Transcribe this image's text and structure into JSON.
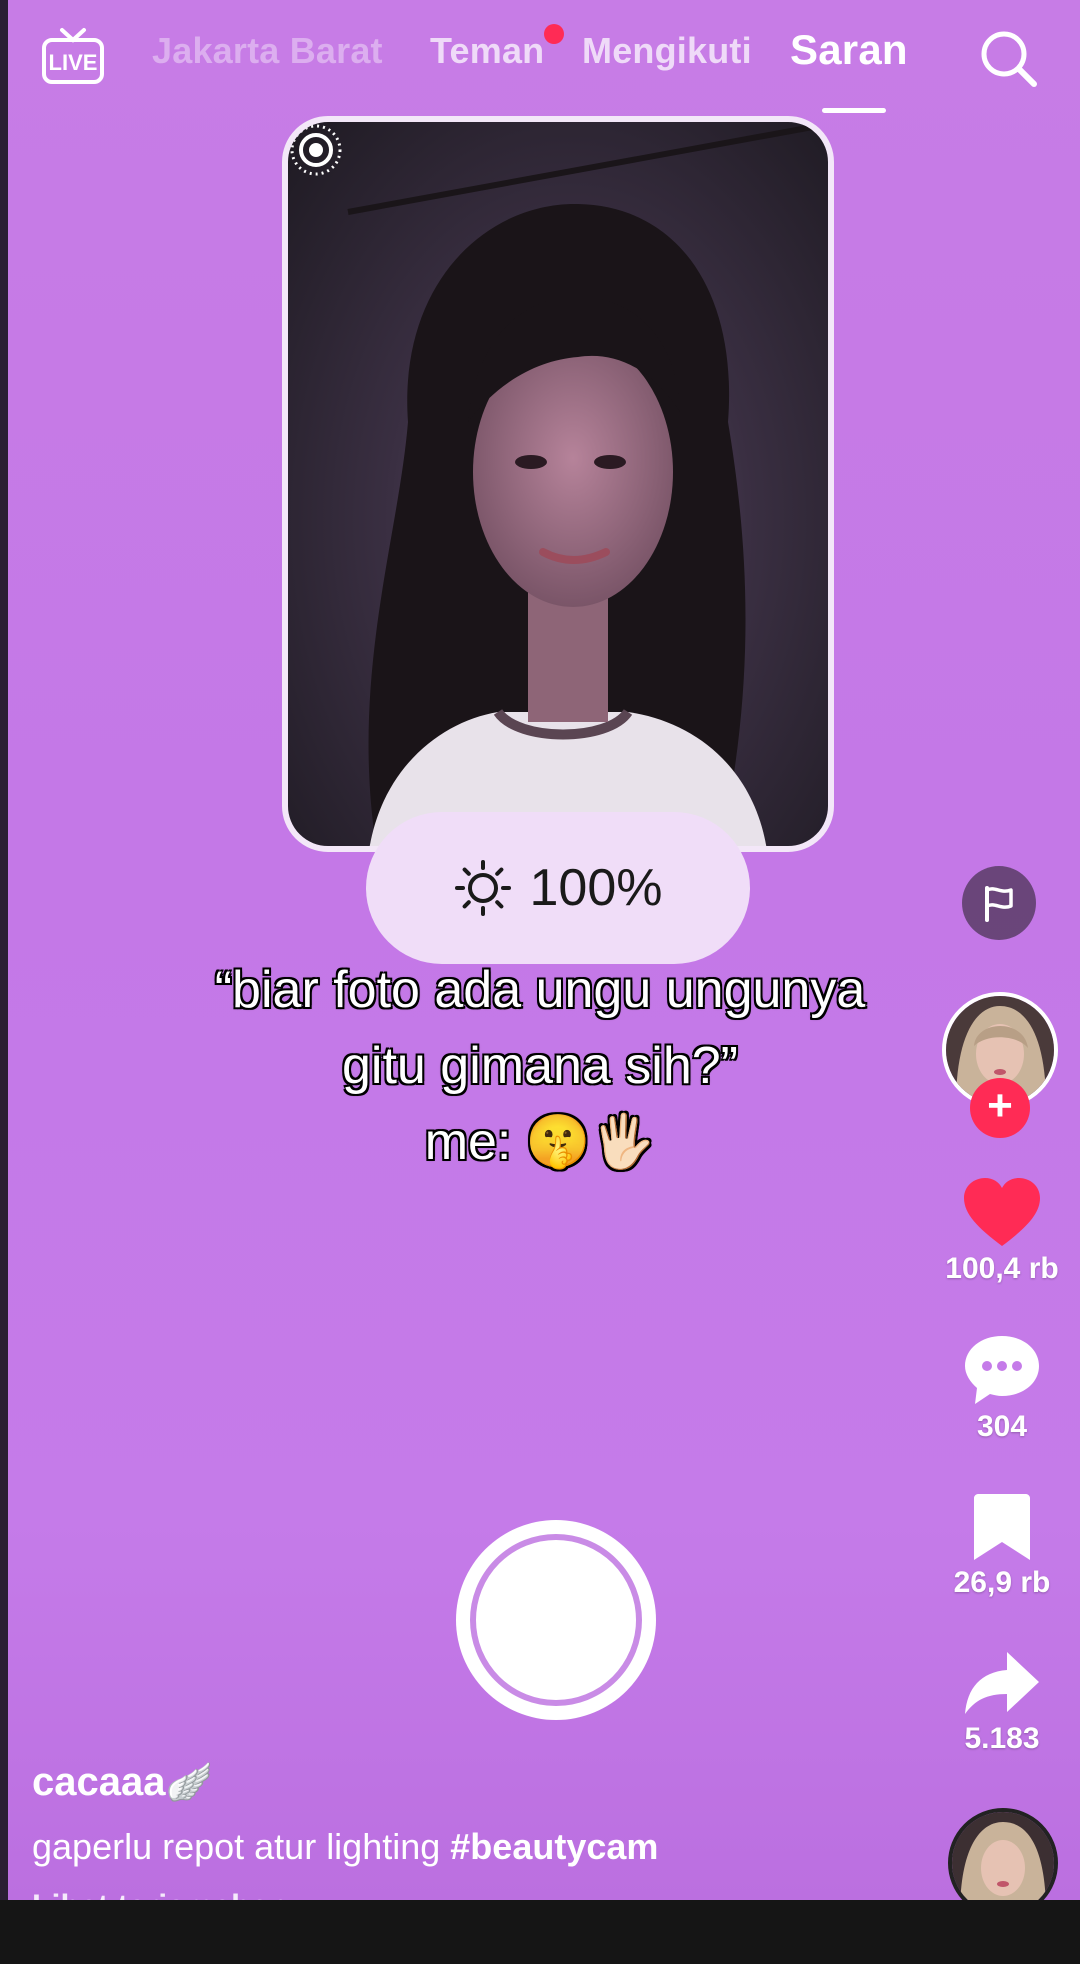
{
  "top_nav": {
    "live_label": "LIVE",
    "tabs": [
      {
        "label": "Jakarta Barat"
      },
      {
        "label": "Teman"
      },
      {
        "label": "Mengikuti"
      },
      {
        "label": "Saran"
      }
    ]
  },
  "camera": {
    "brightness": "100%"
  },
  "caption": {
    "line1": "“biar foto ada ungu ungunya",
    "line2": "gitu gimana sih?”",
    "line3": "me: 🤫🖐🏻"
  },
  "actions": {
    "likes": "100,4 rb",
    "comments": "304",
    "saves": "26,9 rb",
    "shares": "5.183",
    "follow_symbol": "+"
  },
  "post": {
    "username": "cacaaa",
    "username_emoji": "🪽",
    "description": "gaperlu repot atur lighting ",
    "hashtag": "#beautycam",
    "translate_link": "Lihat terjemahan"
  },
  "colors": {
    "background": "#c57be9",
    "like_red": "#ff2b55"
  }
}
